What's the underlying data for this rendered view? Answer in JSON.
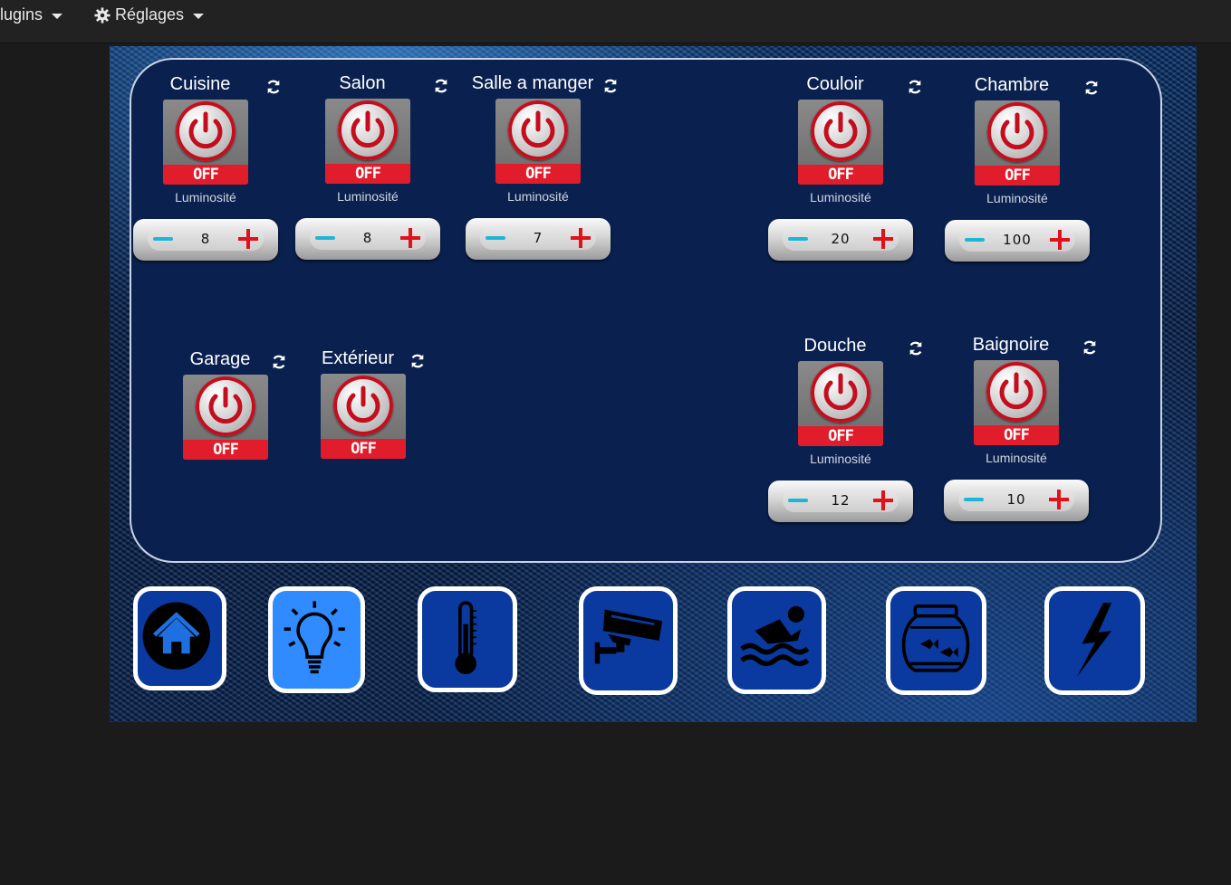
{
  "nav": {
    "plugins_label": "lugins",
    "settings_label": "Réglages"
  },
  "lights": [
    {
      "name": "Cuisine",
      "state": "OFF",
      "brightness_label": "Luminosité",
      "brightness": "8"
    },
    {
      "name": "Salon",
      "state": "OFF",
      "brightness_label": "Luminosité",
      "brightness": "8"
    },
    {
      "name": "Salle a manger",
      "state": "OFF",
      "brightness_label": "Luminosité",
      "brightness": "7"
    },
    {
      "name": "Couloir",
      "state": "OFF",
      "brightness_label": "Luminosité",
      "brightness": "20"
    },
    {
      "name": "Chambre",
      "state": "OFF",
      "brightness_label": "Luminosité",
      "brightness": "100"
    },
    {
      "name": "Garage",
      "state": "OFF"
    },
    {
      "name": "Extérieur",
      "state": "OFF"
    },
    {
      "name": "Douche",
      "state": "OFF",
      "brightness_label": "Luminosité",
      "brightness": "12"
    },
    {
      "name": "Baignoire",
      "state": "OFF",
      "brightness_label": "Luminosité",
      "brightness": "10"
    }
  ],
  "bottom_nav": [
    {
      "icon": "home-icon",
      "active": false
    },
    {
      "icon": "lightbulb-icon",
      "active": true
    },
    {
      "icon": "thermometer-icon",
      "active": false
    },
    {
      "icon": "camera-icon",
      "active": false
    },
    {
      "icon": "swimmer-icon",
      "active": false
    },
    {
      "icon": "fishbowl-icon",
      "active": false
    },
    {
      "icon": "lightning-icon",
      "active": false
    }
  ],
  "colors": {
    "off_red": "#e11d2b",
    "panel_bg": "#0a2150",
    "active_nav": "#2f8bff",
    "nav_bg": "#0a3aa0"
  }
}
